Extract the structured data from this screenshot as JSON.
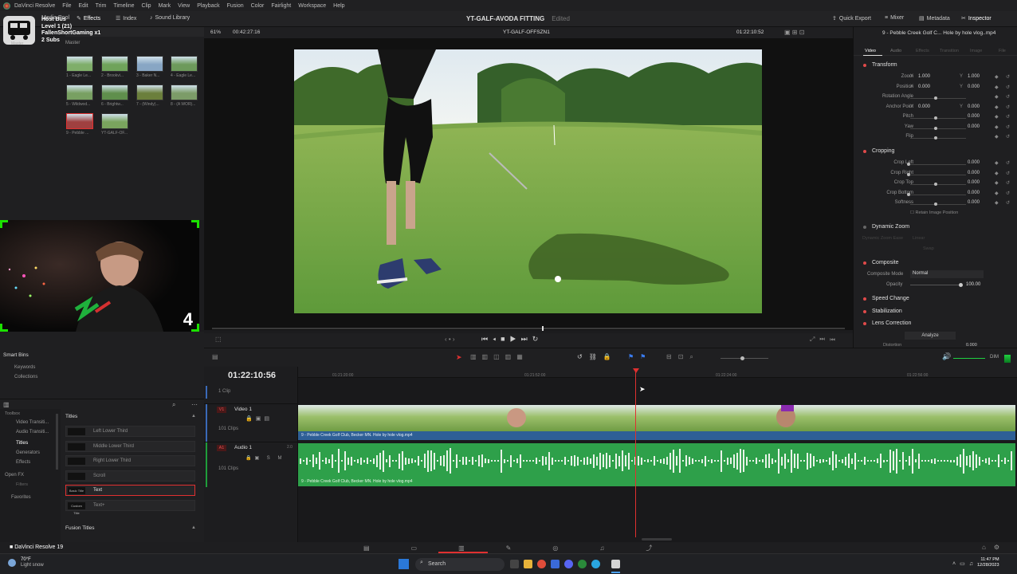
{
  "app": {
    "menu": [
      "DaVinci Resolve",
      "File",
      "Edit",
      "Trim",
      "Timeline",
      "Clip",
      "Mark",
      "View",
      "Playback",
      "Fusion",
      "Color",
      "Fairlight",
      "Workspace",
      "Help"
    ],
    "project_title": "YT-GALF-AVODA FITTING",
    "edited": "Edited",
    "right_tools": [
      "Quick Export",
      "Mixer",
      "Metadata",
      "Inspector"
    ]
  },
  "toolbar_left": {
    "media_pool": "Media Pool",
    "effects": "Effects",
    "index": "Index",
    "sound_library": "Sound Library"
  },
  "overlay": {
    "name": "Host Bus",
    "level": "Level 1 (21)",
    "gifter": "FallenShortGaming x1",
    "subs": "2 Subs",
    "master_small": "Master",
    "corner_number": "4"
  },
  "viewer_bar": {
    "zoom": "61%",
    "timecode_left": "00:42:27:16",
    "timeline_name": "YT-GALF-OFFSZN1",
    "timecode_right": "01:22:10:52",
    "clip_title": "9 - Pebble Creek Golf C... Hole by hole vlog..mp4"
  },
  "media_pool": {
    "bin": "Master",
    "clips": [
      {
        "label": "1 - Eagle Le...",
        "color": "#7fae6a"
      },
      {
        "label": "2 - Brookvi...",
        "color": "#6fa35a"
      },
      {
        "label": "3 - Baker N...",
        "color": "#88a6c4"
      },
      {
        "label": "4 - Eagle Le...",
        "color": "#6d9a5b"
      },
      {
        "label": "5 - Wildwod...",
        "color": "#78a062"
      },
      {
        "label": "6 - Brightw...",
        "color": "#5f8f4c"
      },
      {
        "label": "7 - (Windy)...",
        "color": "#6b7f3c"
      },
      {
        "label": "8 - (A WOR)...",
        "color": "#7c9c68"
      },
      {
        "label": "9 - Pebble ...",
        "color": "#a04040"
      },
      {
        "label": "YT-GALF-OF...",
        "color": "#7aa45e"
      }
    ]
  },
  "smart_bins": {
    "title": "Smart Bins",
    "items": [
      "Keywords",
      "Collections"
    ]
  },
  "effects_panel": {
    "tree": [
      "Toolbox",
      "Video Transiti...",
      "Audio Transiti...",
      "Titles",
      "Generators",
      "Effects",
      "Open FX",
      "Filters"
    ],
    "favorites": "Favorites",
    "titles_header": "Titles",
    "titles": [
      {
        "icon": "",
        "name": "Left Lower Third"
      },
      {
        "icon": "",
        "name": "Middle Lower Third"
      },
      {
        "icon": "",
        "name": "Right Lower Third"
      },
      {
        "icon": "",
        "name": "Scroll"
      },
      {
        "icon": "Basic Title",
        "name": "Text"
      },
      {
        "icon": "Custom Title",
        "name": "Text+"
      }
    ],
    "fusion_titles": "Fusion Titles"
  },
  "inspector": {
    "tabs": [
      "Video",
      "Audio",
      "Effects",
      "Transition",
      "Image",
      "File"
    ],
    "transform": {
      "title": "Transform",
      "rows": [
        {
          "label": "Zoom",
          "x": "1.000",
          "y": "1.000"
        },
        {
          "label": "Position",
          "x": "0.000",
          "y": "0.000"
        },
        {
          "label": "Rotation Angle",
          "v": ""
        },
        {
          "label": "Anchor Point",
          "x": "0.000",
          "y": "0.000"
        },
        {
          "label": "Pitch",
          "v": "0.000"
        },
        {
          "label": "Yaw",
          "v": "0.000"
        },
        {
          "label": "Flip",
          "v": ""
        }
      ]
    },
    "cropping": {
      "title": "Cropping",
      "rows": [
        {
          "label": "Crop Left",
          "v": "0.000"
        },
        {
          "label": "Crop Right",
          "v": "0.000"
        },
        {
          "label": "Crop Top",
          "v": "0.000"
        },
        {
          "label": "Crop Bottom",
          "v": "0.000"
        },
        {
          "label": "Softness",
          "v": "0.000"
        }
      ],
      "retain": "Retain Image Position"
    },
    "dynamic_zoom": {
      "title": "Dynamic Zoom",
      "ease_label": "Dynamic Zoom Ease",
      "ease_value": "Linear",
      "swap": "Swap"
    },
    "composite": {
      "title": "Composite",
      "mode_label": "Composite Mode",
      "mode_value": "Normal",
      "opacity_label": "Opacity",
      "opacity_value": "100.00"
    },
    "speed_change": "Speed Change",
    "stabilization": "Stabilization",
    "lens_correction": "Lens Correction",
    "analyze": "Analyze",
    "distortion_label": "Distortion",
    "distortion_value": "0.000"
  },
  "timeline": {
    "timecode": "01:22:10:56",
    "ruler": [
      "01:21:20:00",
      "01:21:52:00",
      "01:22:24:00",
      "01:22:56:00"
    ],
    "top_clip_count": "1 Clip",
    "video_track": {
      "id": "V1",
      "name": "Video 1",
      "clips": "101 Clips",
      "clip_name": "9 - Pebble Creek Golf Club, Becker MN. Hole by hole vlog.mp4"
    },
    "audio_track": {
      "id": "A1",
      "name": "Audio 1",
      "level": "2.0",
      "clips": "101 Clips",
      "clip_name": "9 - Pebble Creek Golf Club, Becker MN. Hole by hole vlog.mp4"
    },
    "dim": "DIM"
  },
  "statusbar": {
    "app_name": "DaVinci Resolve 19"
  },
  "taskbar": {
    "temperature": "70°F",
    "weather": "Light snow",
    "search": "Search",
    "time": "11:47 PM",
    "date": "12/28/2023"
  }
}
